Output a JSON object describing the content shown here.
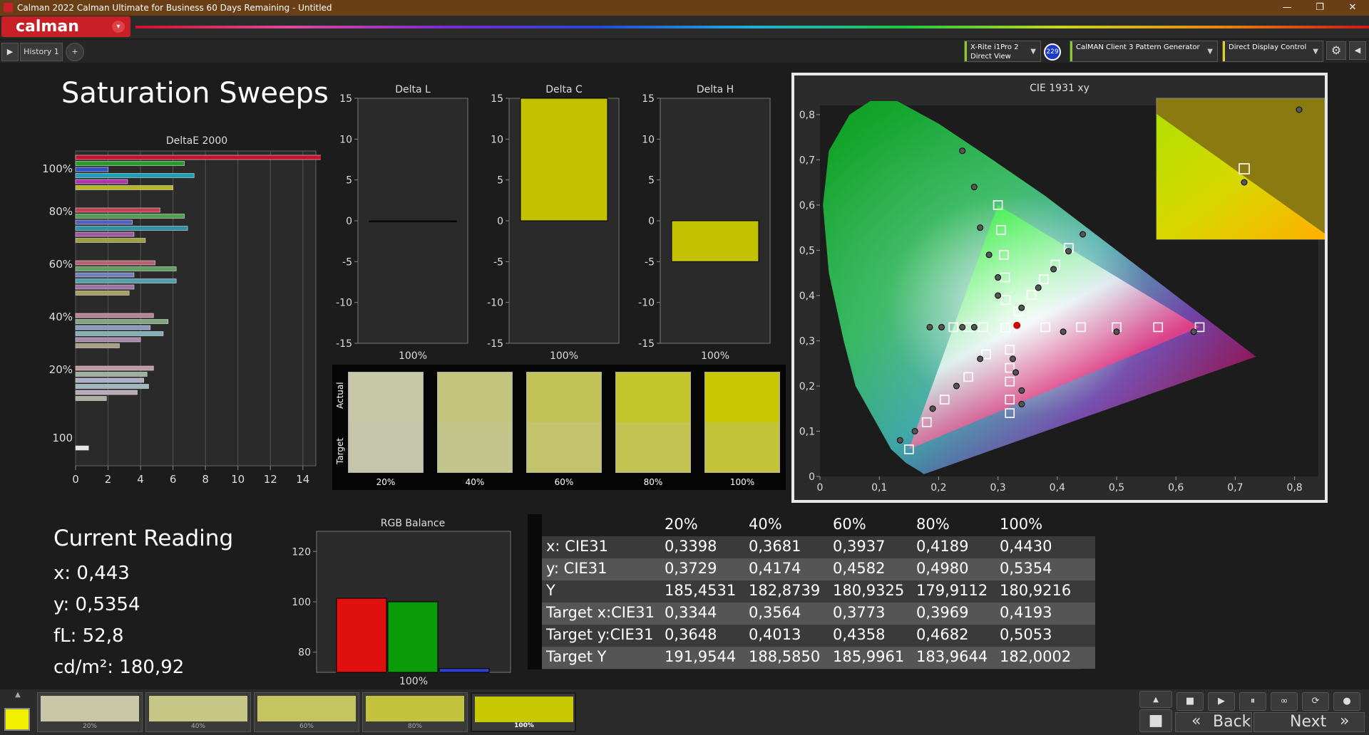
{
  "titlebar": {
    "title": "Calman 2022 Calman Ultimate for Business 60 Days Remaining  - Untitled",
    "min": "—",
    "max": "❐",
    "close": "✕"
  },
  "logo": {
    "text": "calman",
    "menu": "▾"
  },
  "tabs": {
    "play": "▶",
    "history": "History 1",
    "add": "+"
  },
  "devices": {
    "meter_line1": "X-Rite i1Pro 2",
    "meter_line2": "Direct View",
    "meter_badge": "229",
    "pattern_gen": "CalMAN Client 3 Pattern Generator",
    "display_ctrl": "Direct Display Control",
    "gear": "⚙",
    "collapse": "◀"
  },
  "page_title": "Saturation Sweeps",
  "deltae": {
    "title": "DeltaE 2000",
    "y_labels": [
      "100%",
      "80%",
      "60%",
      "40%",
      "20%",
      "100"
    ],
    "x_ticks": [
      "0",
      "2",
      "4",
      "6",
      "8",
      "10",
      "12",
      "14"
    ]
  },
  "delta_charts": [
    {
      "title": "Delta L",
      "xlabel": "100%",
      "value": -0.1,
      "color": "#1a1a1a"
    },
    {
      "title": "Delta C",
      "xlabel": "100%",
      "value": 15.2,
      "color": "#c2c200"
    },
    {
      "title": "Delta H",
      "xlabel": "100%",
      "value": -5.0,
      "color": "#c2c200"
    }
  ],
  "delta_yticks": [
    "15",
    "10",
    "5",
    "0",
    "-5",
    "-10",
    "-15"
  ],
  "swatches": {
    "actual_label": "Actual",
    "target_label": "Target",
    "items": [
      {
        "label": "20%",
        "actual": "#c6c8a8",
        "target": "#c5c6a9"
      },
      {
        "label": "40%",
        "actual": "#c3c47d",
        "target": "#c4c58a"
      },
      {
        "label": "60%",
        "actual": "#c2c357",
        "target": "#c2c36c"
      },
      {
        "label": "80%",
        "actual": "#c4c42c",
        "target": "#c3c352"
      },
      {
        "label": "100%",
        "actual": "#c8c800",
        "target": "#c3c33a"
      }
    ]
  },
  "cie": {
    "title": "CIE 1931 xy",
    "x_ticks": [
      "0",
      "0,1",
      "0,2",
      "0,3",
      "0,4",
      "0,5",
      "0,6",
      "0,7",
      "0,8"
    ],
    "y_ticks": [
      "0",
      "0,1",
      "0,2",
      "0,3",
      "0,4",
      "0,5",
      "0,6",
      "0,7",
      "0,8"
    ]
  },
  "current_reading": {
    "title": "Current Reading",
    "x": "x: 0,443",
    "y": "y: 0,5354",
    "fl": "fL: 52,8",
    "cdm": "cd/m²: 180,92"
  },
  "rgb_balance": {
    "title": "RGB Balance",
    "xlabel": "100%",
    "y_ticks": [
      "120",
      "100",
      "80"
    ],
    "ylim": [
      72,
      128
    ],
    "bars": [
      {
        "name": "R",
        "value": 101.4,
        "color": "#e01010"
      },
      {
        "name": "G",
        "value": 100.0,
        "color": "#0a9a0a"
      },
      {
        "name": "B",
        "value": 73.5,
        "color": "#3040d0"
      }
    ]
  },
  "table": {
    "headers": [
      "",
      "20%",
      "40%",
      "60%",
      "80%",
      "100%"
    ],
    "rows": [
      [
        "x: CIE31",
        "0,3398",
        "0,3681",
        "0,3937",
        "0,4189",
        "0,4430"
      ],
      [
        "y: CIE31",
        "0,3729",
        "0,4174",
        "0,4582",
        "0,4980",
        "0,5354"
      ],
      [
        "Y",
        "185,4531",
        "182,8739",
        "180,9325",
        "179,9112",
        "180,9216"
      ],
      [
        "Target x:CIE31",
        "0,3344",
        "0,3564",
        "0,3773",
        "0,3969",
        "0,4193"
      ],
      [
        "Target y:CIE31",
        "0,3648",
        "0,4013",
        "0,4358",
        "0,4682",
        "0,5053"
      ],
      [
        "Target Y",
        "191,9544",
        "188,5850",
        "185,9961",
        "183,9644",
        "182,0002"
      ]
    ]
  },
  "bottom": {
    "current_color": "#f0f000",
    "up_icon": "▲",
    "swatches": [
      {
        "label": "20%",
        "color": "#c8c8a8"
      },
      {
        "label": "40%",
        "color": "#c6c785"
      },
      {
        "label": "60%",
        "color": "#c4c560"
      },
      {
        "label": "80%",
        "color": "#c2c23c"
      },
      {
        "label": "100%",
        "color": "#c8c800"
      }
    ],
    "controls": [
      "■",
      "▶",
      "⏸",
      "∞",
      "⟳",
      "●"
    ],
    "stop": "■",
    "back": "Back",
    "next": "Next",
    "back_icon": "«",
    "next_icon": "»"
  }
}
